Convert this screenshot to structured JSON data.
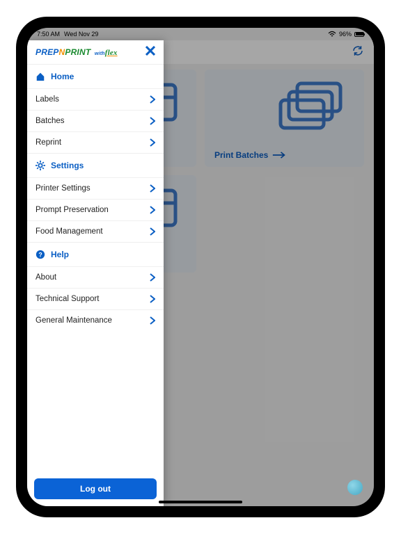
{
  "status": {
    "time": "7:50 AM",
    "date": "Wed Nov 29",
    "battery": "96%"
  },
  "logo": {
    "prep": "PREP",
    "n": "N",
    "print": "PRINT",
    "with": "with",
    "flex": "flex"
  },
  "drawer": {
    "home": {
      "title": "Home",
      "items": [
        "Labels",
        "Batches",
        "Reprint"
      ]
    },
    "settings": {
      "title": "Settings",
      "items": [
        "Printer Settings",
        "Prompt Preservation",
        "Food Management"
      ]
    },
    "help": {
      "title": "Help",
      "items": [
        "About",
        "Technical Support",
        "General Maintenance"
      ]
    },
    "logout": "Log out"
  },
  "main": {
    "tile_batches": "Print Batches"
  }
}
